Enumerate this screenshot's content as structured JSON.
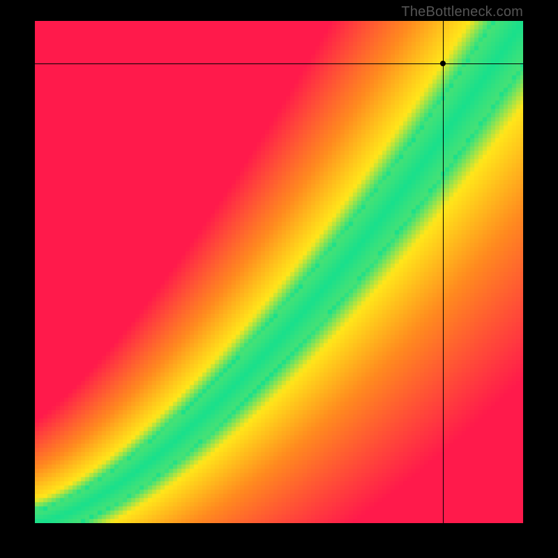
{
  "watermark": "TheBottleneck.com",
  "chart_data": {
    "type": "heatmap",
    "title": "",
    "xlabel": "",
    "ylabel": "",
    "xlim": [
      0,
      1
    ],
    "ylim": [
      0,
      1
    ],
    "legend": false,
    "grid": false,
    "colormap_note": "red (worst) -> orange -> yellow -> green (optimal) -> yellow -> orange -> red",
    "ideal_curve_note": "green band follows roughly y = x^1.5 (balanced line), nonlinear S-shape from bottom-left to top-right",
    "series": [
      {
        "name": "ideal-balance-curve",
        "x": [
          0.0,
          0.1,
          0.2,
          0.3,
          0.4,
          0.5,
          0.6,
          0.7,
          0.8,
          0.9,
          1.0
        ],
        "y": [
          0.0,
          0.03,
          0.09,
          0.17,
          0.27,
          0.38,
          0.5,
          0.63,
          0.76,
          0.89,
          1.0
        ]
      }
    ],
    "crosshair": {
      "x": 0.835,
      "y": 0.915
    },
    "marker": {
      "x": 0.835,
      "y": 0.915
    }
  },
  "colors": {
    "red": "#ff1a4b",
    "orange": "#ff8a1f",
    "yellow": "#ffe61a",
    "green": "#18e08c"
  }
}
